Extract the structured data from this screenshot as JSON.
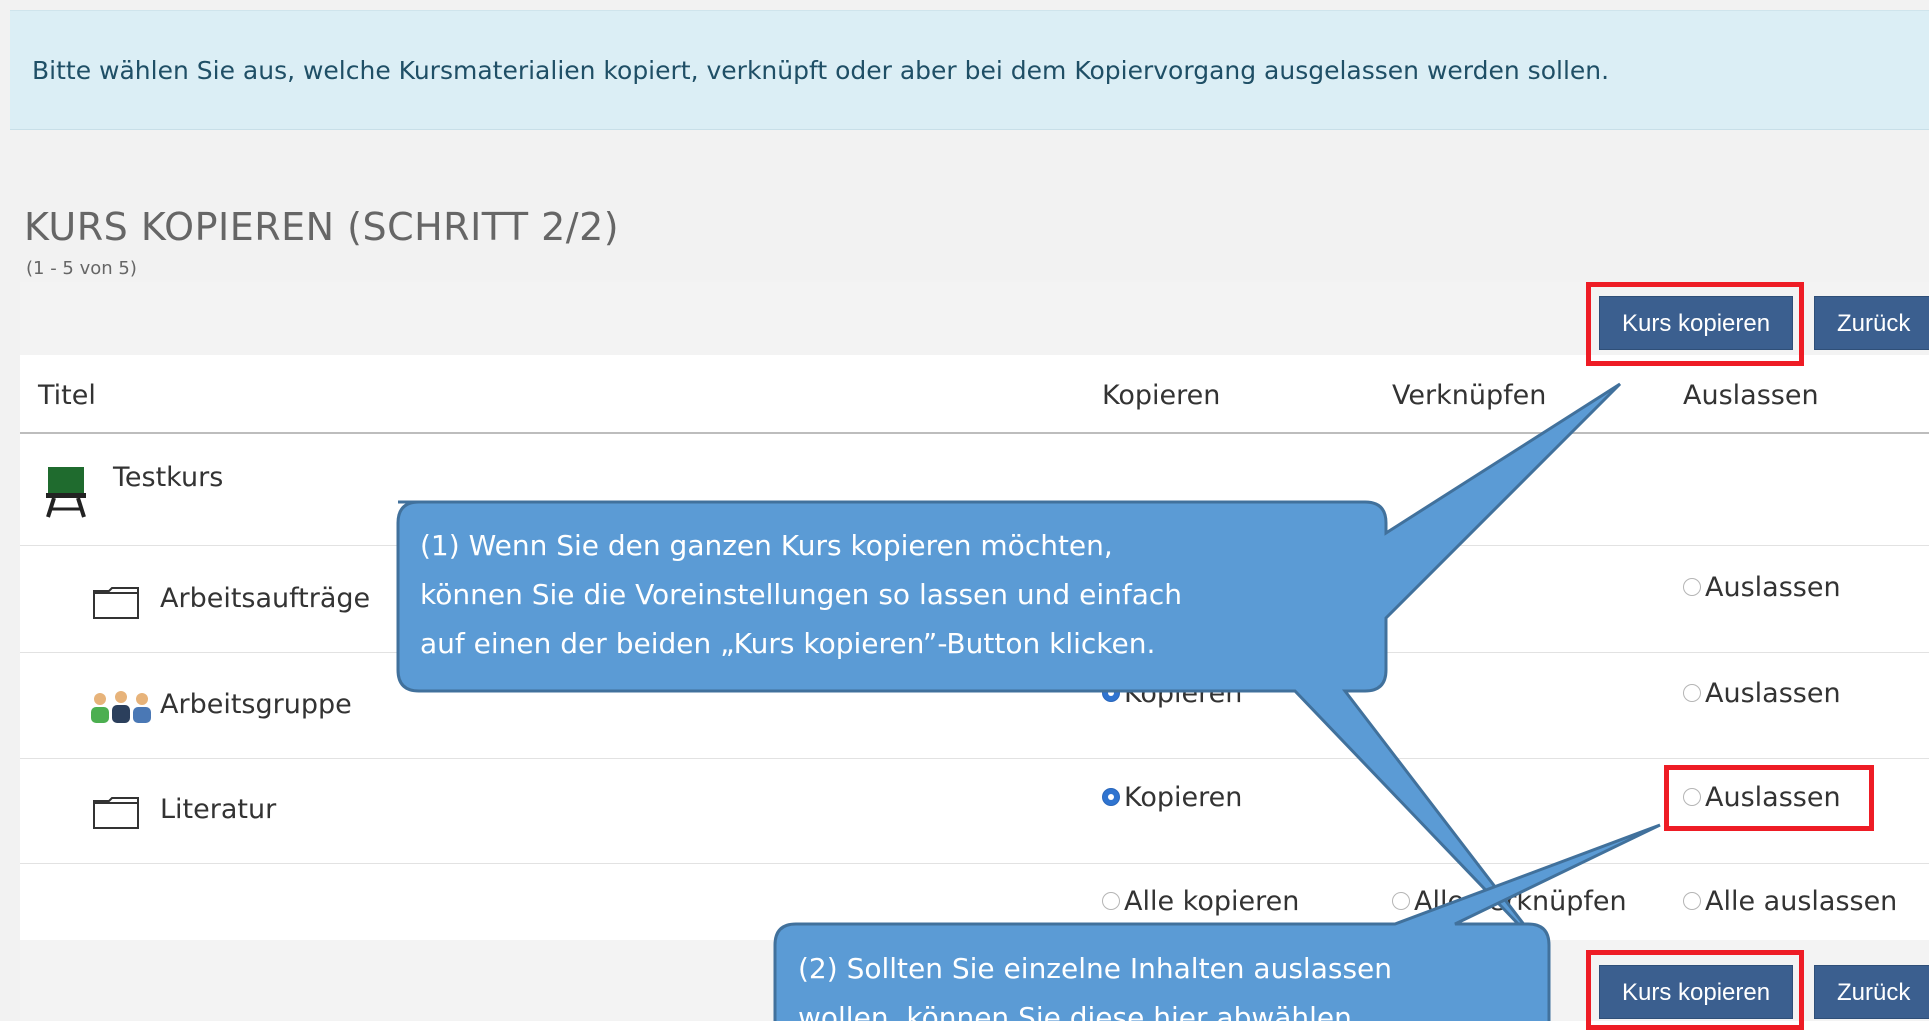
{
  "info": {
    "message": "Bitte wählen Sie aus, welche Kursmaterialien kopiert, verknüpft oder aber bei dem Kopiervorgang ausgelassen werden sollen."
  },
  "page": {
    "title": "KURS KOPIEREN (SCHRITT 2/2)",
    "count": "(1 - 5 von 5)"
  },
  "toolbar": {
    "copy_label": "Kurs kopieren",
    "back_label": "Zurück"
  },
  "table": {
    "headers": [
      "Titel",
      "Kopieren",
      "Verknüpfen",
      "Auslassen"
    ],
    "rows": [
      {
        "title": "Testkurs",
        "icon": "course-board-icon"
      },
      {
        "title": "Arbeitsaufträge",
        "icon": "folder-icon",
        "omit": "Auslassen"
      },
      {
        "title": "Arbeitsgruppe",
        "icon": "group-icon",
        "copy": "Kopieren",
        "omit": "Auslassen"
      },
      {
        "title": "Literatur",
        "icon": "folder-icon",
        "copy": "Kopieren",
        "omit": "Auslassen"
      }
    ],
    "footer": {
      "copy_all": "Alle kopieren",
      "link_all": "Alle verknüpfen",
      "omit_all": "Alle auslassen"
    }
  },
  "callouts": {
    "first": [
      "(1) Wenn Sie den ganzen Kurs kopieren möchten,",
      "können Sie die Voreinstellungen so lassen und einfach",
      "auf einen der beiden „Kurs kopieren”-Button klicken."
    ],
    "second": [
      "(2) Sollten Sie einzelne Inhalten auslassen",
      "wollen, können Sie diese hier abwählen."
    ]
  },
  "colors": {
    "info_bg": "#dbeef5",
    "button_bg": "#3b5f8f",
    "highlight": "#ee1c25",
    "callout_fill": "#5b9bd5",
    "callout_stroke": "#41719c",
    "radio_checked": "#2f74d0"
  }
}
